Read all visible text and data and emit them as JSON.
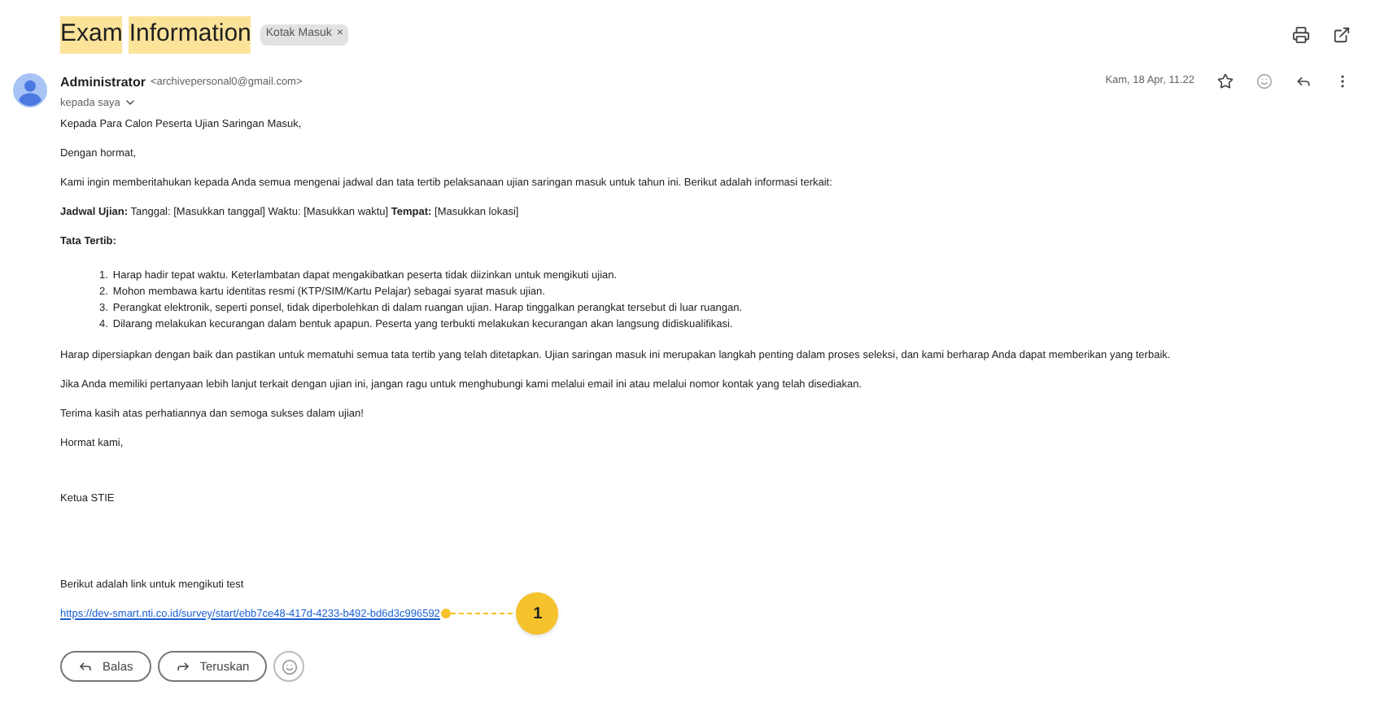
{
  "subject": {
    "words": [
      {
        "text": "Exam",
        "highlighted": true
      },
      {
        "text": "Information",
        "highlighted": true
      }
    ],
    "label": "Kotak Masuk",
    "label_close": "×"
  },
  "sender": {
    "name": "Administrator",
    "email": "<archivepersonal0@gmail.com>",
    "recipient": "kepada saya",
    "date": "Kam, 18 Apr, 11.22"
  },
  "body": {
    "greeting": "Kepada Para Calon Peserta Ujian Saringan Masuk,",
    "salutation": "Dengan hormat,",
    "intro": "Kami ingin memberitahukan kepada Anda semua mengenai jadwal dan tata tertib pelaksanaan ujian saringan masuk untuk tahun ini. Berikut adalah informasi terkait:",
    "schedule": "**Jadwal Ujian:** Tanggal: [Masukkan tanggal] Waktu: [Masukkan waktu] **Tempat:** [Masukkan lokasi]",
    "rules_heading": "Tata Tertib:",
    "rules": [
      {
        "number": "1.",
        "text": "Harap hadir tepat waktu. Keterlambatan dapat mengakibatkan peserta tidak diizinkan untuk mengikuti ujian."
      },
      {
        "number": "2.",
        "text": "Mohon membawa kartu identitas resmi (KTP/SIM/Kartu Pelajar) sebagai syarat masuk ujian."
      },
      {
        "number": "3.",
        "text": "Perangkat elektronik, seperti ponsel, tidak diperbolehkan di dalam ruangan ujian. Harap tinggalkan perangkat tersebut di luar ruangan."
      },
      {
        "number": "4.",
        "text": "Dilarang melakukan kecurangan dalam bentuk apapun. Peserta yang terbukti melakukan kecurangan akan langsung didiskualifikasi."
      }
    ],
    "paragraphs": [
      "Harap dipersiapkan dengan baik dan pastikan untuk mematuhi semua tata tertib yang telah ditetapkan. Ujian saringan masuk ini merupakan langkah penting dalam proses seleksi, dan kami berharap Anda dapat memberikan yang terbaik.",
      "Jika Anda memiliki pertanyaan lebih lanjut terkait dengan ujian ini, jangan ragu untuk menghubungi kami melalui email ini atau melalui nomor kontak yang telah disediakan.",
      "Terima kasih atas perhatiannya dan semoga sukses dalam ujian!",
      "Hormat kami,"
    ],
    "signature": "Ketua STIE",
    "link_intro": "Berikut adalah link untuk mengikuti test",
    "link": "https://dev-smart.nti.co.id/survey/start/ebb7ce48-417d-4233-b492-bd6d3c996592"
  },
  "annotation": "1",
  "actions": [
    "Balas",
    "Teruskan"
  ]
}
